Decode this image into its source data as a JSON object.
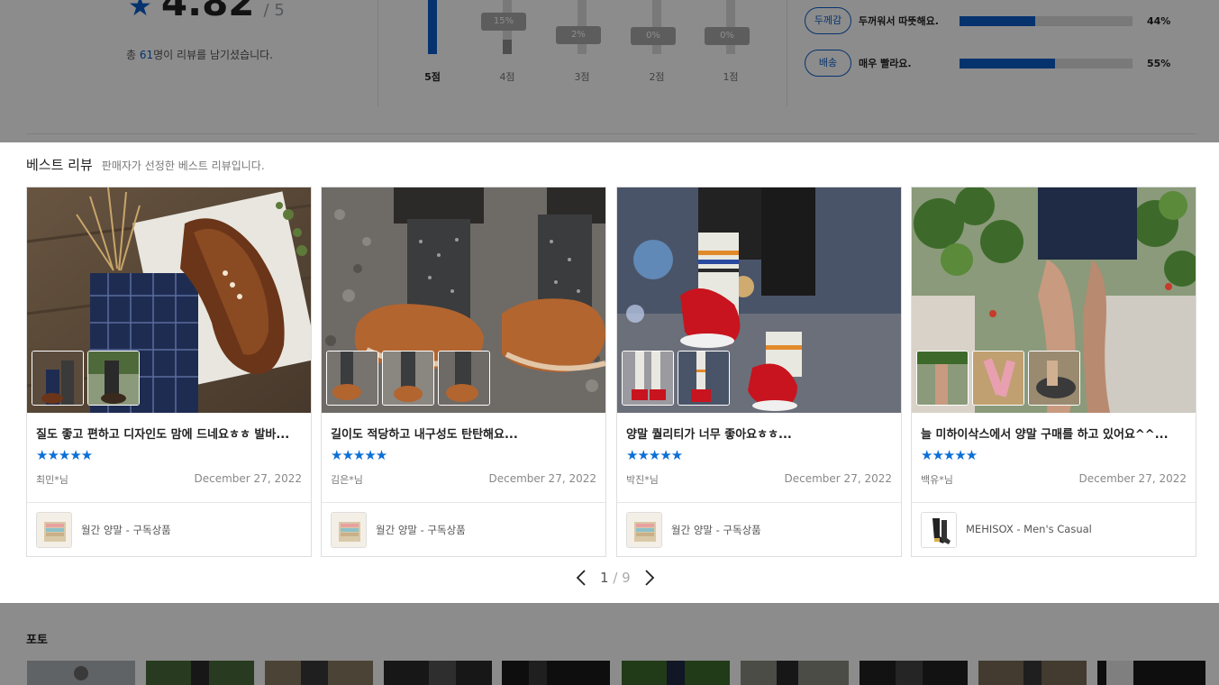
{
  "summary": {
    "score": "4.82",
    "out_of": "/ 5",
    "total_prefix": "총 ",
    "total_count": "61",
    "total_suffix": "명이 리뷰를 남기셨습니다.",
    "bars": [
      {
        "label": "5점",
        "fill": 1.0,
        "pill": ""
      },
      {
        "label": "4점",
        "fill": 0.15,
        "pill": "15%"
      },
      {
        "label": "3점",
        "fill": 0.02,
        "pill": "2%"
      },
      {
        "label": "2점",
        "fill": 0.0,
        "pill": "0%"
      },
      {
        "label": "1점",
        "fill": 0.0,
        "pill": "0%"
      }
    ],
    "tags": [
      {
        "chip": "두께감",
        "text": "두꺼워서 따뜻해요.",
        "percent": "44%",
        "fill": 0.44
      },
      {
        "chip": "배송",
        "text": "매우 빨라요.",
        "percent": "55%",
        "fill": 0.55
      }
    ]
  },
  "best": {
    "title": "베스트 리뷰",
    "subtitle": "판매자가 선정한 베스트 리뷰입니다.",
    "cards": [
      {
        "title": "질도 좋고 편하고 디자인도 맘에 드네요ㅎㅎ 발바...",
        "stars": "★★★★★",
        "author": "최민*님",
        "date": "December 27, 2022",
        "product": "월간 양말 - 구독상품"
      },
      {
        "title": "길이도 적당하고 내구성도 탄탄해요...",
        "stars": "★★★★★",
        "author": "김은*님",
        "date": "December 27, 2022",
        "product": "월간 양말 - 구독상품"
      },
      {
        "title": "양말 퀄리티가 너무 좋아요ㅎㅎ...",
        "stars": "★★★★★",
        "author": "박진*님",
        "date": "December 27, 2022",
        "product": "월간 양말 - 구독상품"
      },
      {
        "title": "늘 미하이삭스에서 양말 구매를 하고 있어요^^...",
        "stars": "★★★★★",
        "author": "백유*님",
        "date": "December 27, 2022",
        "product": "MEHISOX - Men's Casual"
      }
    ],
    "pager": {
      "current": "1",
      "sep": " / ",
      "total": "9"
    }
  },
  "photos": {
    "title": "포토"
  },
  "colors": {
    "accent": "#0b5ec8",
    "star": "#0b6fd6",
    "dim_overlay": "rgba(0,0,0,0.45)"
  }
}
